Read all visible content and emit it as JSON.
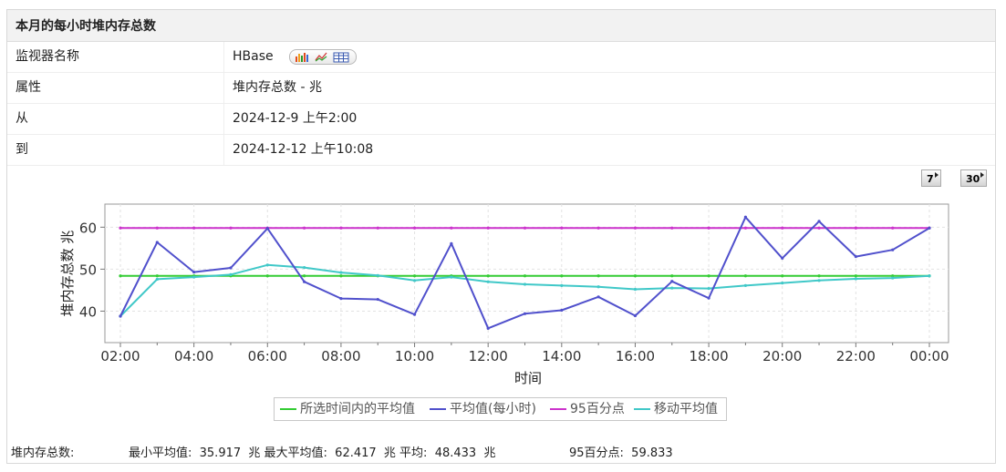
{
  "panel": {
    "title": "本月的每小时堆内存总数"
  },
  "details": [
    {
      "key": "监视器名称",
      "value": "HBase"
    },
    {
      "key": "属性",
      "value": "堆内存总数 - 兆"
    },
    {
      "key": "从",
      "value": "2024-12-9 上午2:00"
    },
    {
      "key": "到",
      "value": "2024-12-12 上午10:08"
    }
  ],
  "icons": [
    "bar-chart-icon",
    "line-chart-icon",
    "table-icon"
  ],
  "nav_buttons": {
    "seven": "7",
    "thirty": "30"
  },
  "colors": {
    "selected_avg": "#33cc33",
    "hourly_avg": "#5050cc",
    "p95": "#cc33cc",
    "moving_avg": "#40c8c8"
  },
  "chart_data": {
    "type": "line",
    "xlabel": "时间",
    "ylabel": "堆内存总数 兆",
    "ylim": [
      32.5,
      65.5
    ],
    "yticks": [
      40,
      50,
      60
    ],
    "categories": [
      "02:00",
      "03:00",
      "04:00",
      "05:00",
      "06:00",
      "07:00",
      "08:00",
      "09:00",
      "10:00",
      "11:00",
      "12:00",
      "13:00",
      "14:00",
      "15:00",
      "16:00",
      "17:00",
      "18:00",
      "19:00",
      "20:00",
      "21:00",
      "22:00",
      "23:00",
      "00:00"
    ],
    "tick_labels": [
      "02:00",
      "04:00",
      "06:00",
      "08:00",
      "10:00",
      "12:00",
      "14:00",
      "16:00",
      "18:00",
      "20:00",
      "22:00",
      "00:00"
    ],
    "grid": true,
    "legend_position": "bottom",
    "series": [
      {
        "name": "所选时间内的平均值",
        "color": "#33cc33",
        "values": [
          48.4,
          48.4,
          48.4,
          48.4,
          48.4,
          48.4,
          48.4,
          48.4,
          48.4,
          48.4,
          48.4,
          48.4,
          48.4,
          48.4,
          48.4,
          48.4,
          48.4,
          48.4,
          48.4,
          48.4,
          48.4,
          48.4,
          48.4
        ]
      },
      {
        "name": "平均值(每小时)",
        "color": "#5050cc",
        "values": [
          38.8,
          56.4,
          49.3,
          50.3,
          59.7,
          47.0,
          43.0,
          42.8,
          39.2,
          56.1,
          35.9,
          39.4,
          40.2,
          43.4,
          38.9,
          47.1,
          43.1,
          62.4,
          52.6,
          61.4,
          53.0,
          54.6,
          59.8
        ]
      },
      {
        "name": "95百分点",
        "color": "#cc33cc",
        "values": [
          59.8,
          59.8,
          59.8,
          59.8,
          59.8,
          59.8,
          59.8,
          59.8,
          59.8,
          59.8,
          59.8,
          59.8,
          59.8,
          59.8,
          59.8,
          59.8,
          59.8,
          59.8,
          59.8,
          59.8,
          59.8,
          59.8,
          59.8
        ]
      },
      {
        "name": "移动平均值",
        "color": "#40c8c8",
        "values": [
          38.8,
          47.6,
          48.1,
          48.7,
          51.0,
          50.4,
          49.2,
          48.5,
          47.3,
          48.1,
          47.0,
          46.4,
          46.1,
          45.8,
          45.2,
          45.5,
          45.4,
          46.1,
          46.7,
          47.3,
          47.7,
          47.9,
          48.4
        ]
      }
    ]
  },
  "footer": {
    "label": "堆内存总数:",
    "stats": "最小平均值:  35.917  兆 最大平均值:  62.417  兆 平均:  48.433  兆",
    "p95": "95百分点:  59.833"
  }
}
